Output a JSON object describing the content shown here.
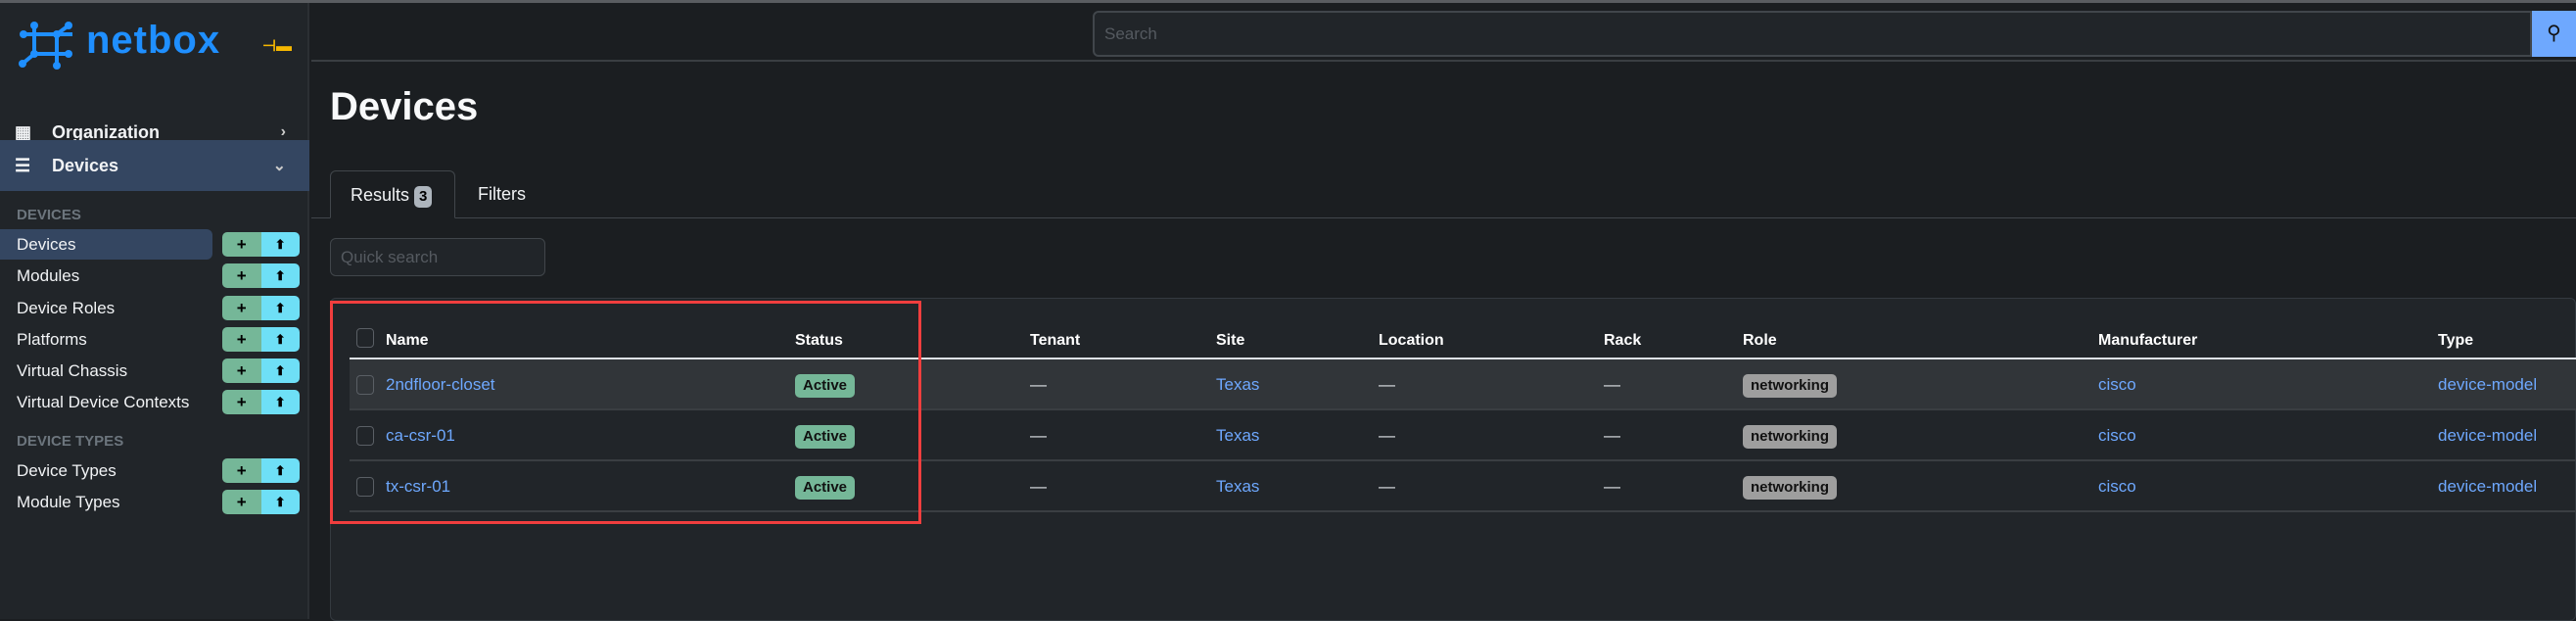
{
  "brand": {
    "name": "netbox",
    "logo_color": "#1f8fff"
  },
  "sidebar": {
    "menus": [
      {
        "label": "Organization",
        "icon": "building-icon",
        "expanded": false
      },
      {
        "label": "Devices",
        "icon": "server-icon",
        "expanded": true
      }
    ],
    "sections": [
      {
        "title": "DEVICES",
        "items": [
          {
            "label": "Devices",
            "active": true
          },
          {
            "label": "Modules"
          },
          {
            "label": "Device Roles"
          },
          {
            "label": "Platforms"
          },
          {
            "label": "Virtual Chassis"
          },
          {
            "label": "Virtual Device Contexts"
          }
        ]
      },
      {
        "title": "DEVICE TYPES",
        "items": [
          {
            "label": "Device Types"
          },
          {
            "label": "Module Types"
          }
        ]
      }
    ],
    "add_symbol": "+",
    "import_symbol": "⬆"
  },
  "header": {
    "search_placeholder": "Search",
    "search_icon": "search-icon"
  },
  "page": {
    "title": "Devices",
    "tabs": [
      {
        "label": "Results",
        "count": "3"
      },
      {
        "label": "Filters"
      }
    ],
    "quick_search_placeholder": "Quick search"
  },
  "table": {
    "columns": [
      "Name",
      "Status",
      "Tenant",
      "Site",
      "Location",
      "Rack",
      "Role",
      "Manufacturer",
      "Type"
    ],
    "rows": [
      {
        "name": "2ndfloor-closet",
        "status": "Active",
        "tenant": "—",
        "site": "Texas",
        "location": "—",
        "rack": "—",
        "role": "networking",
        "manufacturer": "cisco",
        "type": "device-model"
      },
      {
        "name": "ca-csr-01",
        "status": "Active",
        "tenant": "—",
        "site": "Texas",
        "location": "—",
        "rack": "—",
        "role": "networking",
        "manufacturer": "cisco",
        "type": "device-model"
      },
      {
        "name": "tx-csr-01",
        "status": "Active",
        "tenant": "—",
        "site": "Texas",
        "location": "—",
        "rack": "—",
        "role": "networking",
        "manufacturer": "cisco",
        "type": "device-model"
      }
    ]
  },
  "colors": {
    "status_active": "#75b798",
    "role_badge": "#9e9e9e",
    "link": "#6ea8fe",
    "highlight_box": "#f03e3e"
  }
}
